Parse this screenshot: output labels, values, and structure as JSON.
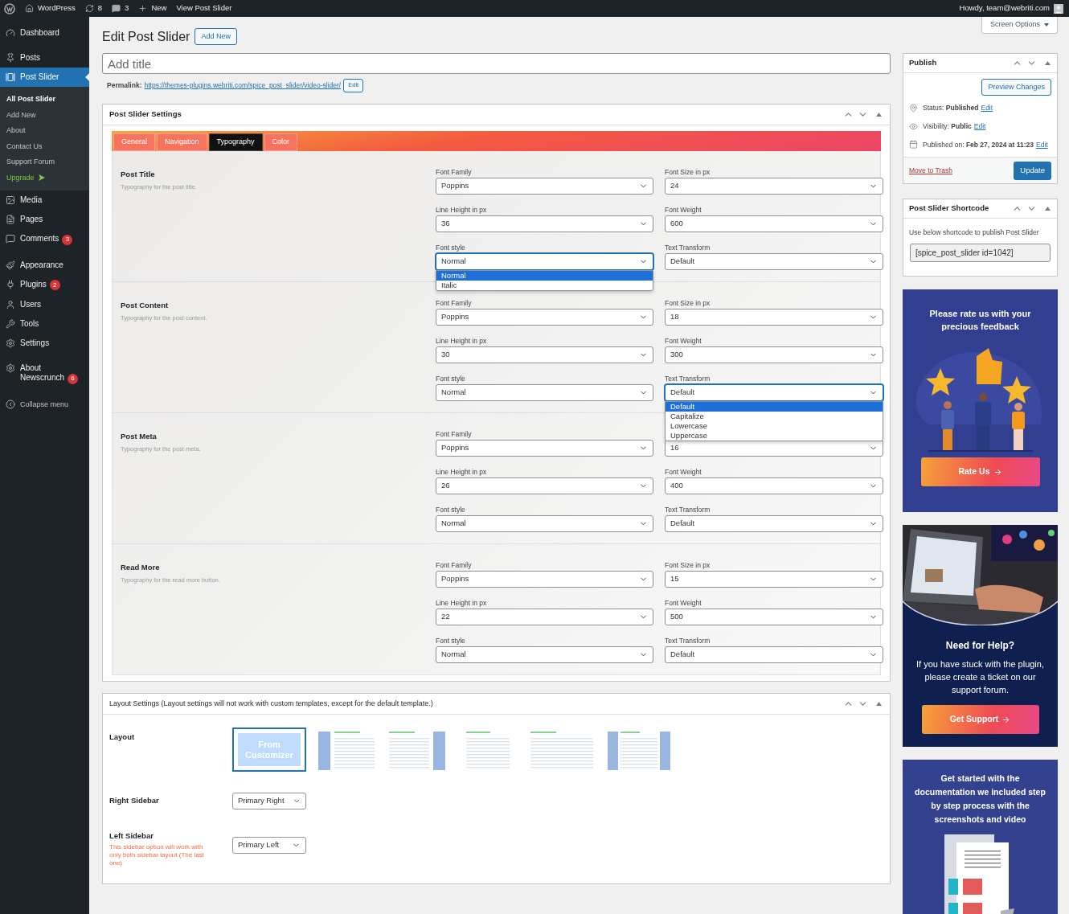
{
  "admin_bar": {
    "site": "WordPress",
    "updates": "8",
    "comments": "3",
    "new": "New",
    "view": "View Post Slider",
    "howdy": "Howdy, team@webriti.com"
  },
  "menu_groups": [
    [
      {
        "label": "Dashboard",
        "selected": false
      }
    ],
    [
      {
        "label": "Posts",
        "selected": false
      },
      {
        "label": "Post Slider",
        "selected": true,
        "children": [
          {
            "label": "All Post Slider",
            "kind": "link",
            "selected": true
          },
          {
            "label": "Add New",
            "kind": "link",
            "selected": false
          },
          {
            "label": "About",
            "kind": "link",
            "selected": false
          },
          {
            "label": "Contact Us",
            "kind": "link",
            "selected": false
          },
          {
            "label": "Support Forum",
            "kind": "link",
            "selected": false
          },
          {
            "label": "Upgrade",
            "kind": "upgrade",
            "selected": false
          }
        ]
      },
      {
        "label": "Media",
        "selected": false
      },
      {
        "label": "Pages",
        "selected": false
      },
      {
        "label": "Comments",
        "selected": false,
        "badge": "3"
      }
    ],
    [
      {
        "label": "Appearance",
        "selected": false
      },
      {
        "label": "Plugins",
        "selected": false,
        "badge": "2"
      },
      {
        "label": "Users",
        "selected": false
      },
      {
        "label": "Tools",
        "selected": false
      },
      {
        "label": "Settings",
        "selected": false
      }
    ],
    [
      {
        "label": "About Newscrunch",
        "selected": false,
        "badge": "6"
      }
    ]
  ],
  "collapse": "Collapse menu",
  "screen_options": "Screen Options",
  "page": {
    "title": "Edit Post Slider",
    "add_new": "Add New"
  },
  "title_field": {
    "placeholder": "Add title"
  },
  "permalink": {
    "label": "Permalink:",
    "url": "https://themes-plugins.webriti.com/spice_post_slider/video-slider/",
    "edit": "Edit"
  },
  "slider_settings": {
    "title": "Post Slider Settings",
    "tabs": [
      {
        "label": "General",
        "selected": false
      },
      {
        "label": "Navigation",
        "selected": false
      },
      {
        "label": "Typography",
        "selected": true
      },
      {
        "label": "Color",
        "selected": false
      }
    ],
    "sections": [
      {
        "title": "Post Title",
        "description": "Typography for the post title.",
        "fields": [
          {
            "label": "Font Family",
            "value": "Poppins",
            "expanded": false
          },
          {
            "label": "Font Size in px",
            "value": "24",
            "expanded": false
          },
          {
            "label": "Line Height in px",
            "value": "36",
            "expanded": false
          },
          {
            "label": "Font Weight",
            "value": "600",
            "expanded": false
          },
          {
            "label": "Font style",
            "value": "Normal",
            "expanded": true,
            "options": [
              {
                "label": "Normal",
                "selected": true
              },
              {
                "label": "Italic",
                "selected": false
              }
            ]
          },
          {
            "label": "Text Transform",
            "value": "Default",
            "expanded": false
          }
        ]
      },
      {
        "title": "Post Content",
        "description": "Typography for the post content.",
        "fields": [
          {
            "label": "Font Family",
            "value": "Poppins",
            "expanded": false
          },
          {
            "label": "Font Size in px",
            "value": "18",
            "expanded": false
          },
          {
            "label": "Line Height in px",
            "value": "30",
            "expanded": false
          },
          {
            "label": "Font Weight",
            "value": "300",
            "expanded": false
          },
          {
            "label": "Font style",
            "value": "Normal",
            "expanded": false
          },
          {
            "label": "Text Transform",
            "value": "Default",
            "expanded": true,
            "options": [
              {
                "label": "Default",
                "selected": true
              },
              {
                "label": "Capitalize",
                "selected": false
              },
              {
                "label": "Lowercase",
                "selected": false
              },
              {
                "label": "Uppercase",
                "selected": false
              }
            ]
          }
        ]
      },
      {
        "title": "Post Meta",
        "description": "Typography for the post meta.",
        "fields": [
          {
            "label": "Font Family",
            "value": "Poppins",
            "expanded": false
          },
          {
            "value": "16",
            "expanded": false
          },
          {
            "label": "Line Height in px",
            "value": "26",
            "expanded": false
          },
          {
            "label": "Font Weight",
            "value": "400",
            "expanded": false
          },
          {
            "label": "Font style",
            "value": "Normal",
            "expanded": false
          },
          {
            "label": "Text Transform",
            "value": "Default",
            "expanded": false
          }
        ]
      },
      {
        "title": "Read More",
        "description": "Typography for the read more button.",
        "fields": [
          {
            "label": "Font Family",
            "value": "Poppins",
            "expanded": false
          },
          {
            "label": "Font Size in px",
            "value": "15",
            "expanded": false
          },
          {
            "label": "Line Height in px",
            "value": "22",
            "expanded": false
          },
          {
            "label": "Font Weight",
            "value": "500",
            "expanded": false
          },
          {
            "label": "Font style",
            "value": "Normal",
            "expanded": false
          },
          {
            "label": "Text Transform",
            "value": "Default",
            "expanded": false
          }
        ]
      }
    ]
  },
  "layout_settings": {
    "title": "Layout Settings (Layout settings will not work with custom templates, except for the default template.)",
    "layout_label": "Layout",
    "layouts": [
      {
        "kind": "customizer",
        "label": "From Customizer",
        "selected": true
      },
      {
        "kind": "left",
        "selected": false
      },
      {
        "kind": "right",
        "selected": false
      },
      {
        "kind": "narrow",
        "selected": false
      },
      {
        "kind": "full",
        "selected": false
      },
      {
        "kind": "both",
        "selected": false
      }
    ],
    "right_sidebar": {
      "label": "Right Sidebar",
      "value": "Primary Right"
    },
    "left_sidebar": {
      "label": "Left Sidebar",
      "note": "This sidebar option will work with only both sidebar layout (The last one)",
      "value": "Primary Left"
    }
  },
  "publish": {
    "title": "Publish",
    "preview": "Preview Changes",
    "rows": [
      {
        "kind": "status",
        "label": "Status:",
        "value": "Published",
        "link": "Edit"
      },
      {
        "kind": "visibility",
        "label": "Visibility:",
        "value": "Public",
        "link": "Edit"
      },
      {
        "kind": "date",
        "label": "Published on:",
        "value": "Feb 27, 2024 at 11:23",
        "link": "Edit"
      }
    ],
    "trash": "Move to Trash",
    "update": "Update"
  },
  "shortcode": {
    "title": "Post Slider Shortcode",
    "description": "Use below shortcode to publish Post Slider",
    "value": "[spice_post_slider id=1042]"
  },
  "promos": [
    {
      "kind": "rate",
      "text": "Please rate us with your precious feedback",
      "button": "Rate Us"
    },
    {
      "kind": "help",
      "heading": "Need for Help?",
      "text": "If you have stuck with the plugin, please create a ticket on our support forum.",
      "button": "Get Support"
    },
    {
      "kind": "docs",
      "text": "Get started with the documentation we included step by step process with the screenshots and video"
    }
  ]
}
